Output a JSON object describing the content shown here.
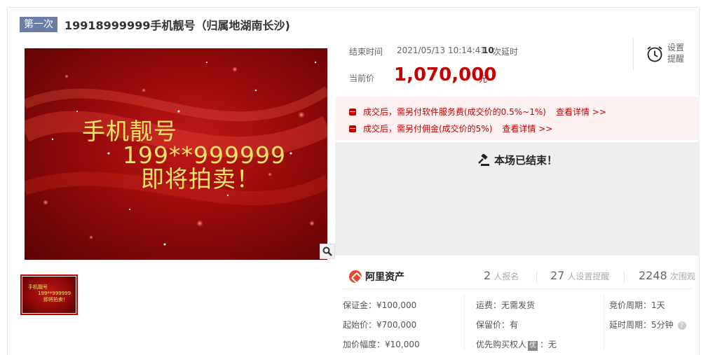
{
  "header": {
    "round_badge": "第一次",
    "title": "19918999999手机靓号（归属地湖南长沙)"
  },
  "image": {
    "line1": "手机靓号",
    "line2": "199**999999",
    "line3": "即将拍卖！",
    "zoom_icon": "magnifier-icon"
  },
  "auction": {
    "end_label": "结束时间",
    "end_time": "2021/05/13 10:14:41",
    "delay_count": "10",
    "delay_label": "次延时",
    "price_label": "当前价",
    "price_value": "1,070,000",
    "price_unit": "元",
    "reminder_label": "设置提醒",
    "reminder_icon": "alarm-clock-icon"
  },
  "notices": [
    {
      "text": "成交后，需另付软件服务费(成交价的0.5%~1%)",
      "link": "查看详情 >>"
    },
    {
      "text": "成交后，需另付佣金(成交价的5%)",
      "link": "查看详情 >>"
    }
  ],
  "status": {
    "icon": "gavel-icon",
    "text": "本场已结束！"
  },
  "platform": {
    "name": "阿里资产",
    "stats": [
      {
        "num": "2",
        "label": "人报名"
      },
      {
        "num": "27",
        "label": "人设置提醒"
      },
      {
        "num": "2248",
        "label": "次围观"
      }
    ]
  },
  "details": {
    "deposit": "保证金：¥100,000",
    "start_price": "起始价：¥700,000",
    "increment": "加价幅度：¥10,000",
    "shipping": "运费：无需发货",
    "reserve": "保留价：有",
    "priority_prefix": "优先购买权人",
    "priority_badge": "优",
    "priority_value": "：无",
    "bid_period": "竞价周期：1天",
    "delay_period": "延时周期：5分钟"
  },
  "colors": {
    "accent": "#c40000",
    "badge": "#6b7ea8",
    "notice_bg": "#fef1f2",
    "status_bg": "#eeeeee"
  }
}
